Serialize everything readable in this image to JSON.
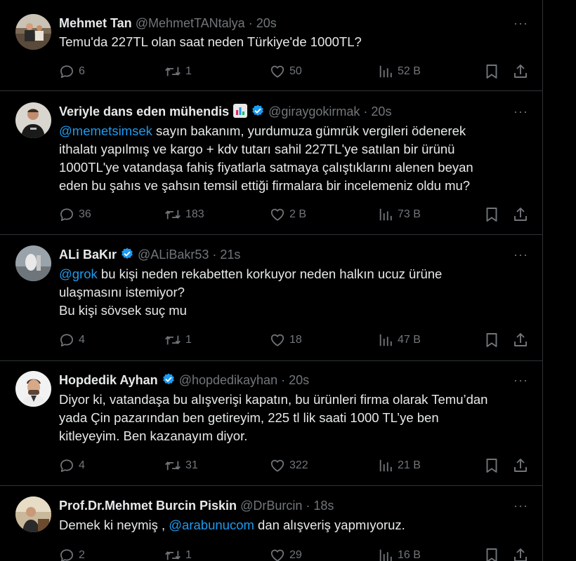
{
  "tweets": [
    {
      "name": "Mehmet Tan",
      "handle": "@MehmetTANtalya",
      "time": "20s",
      "verified": false,
      "body_lines": [
        [
          {
            "t": "Temu'da 227TL olan saat neden Türkiye'de 1000TL?"
          }
        ]
      ],
      "replies": "6",
      "reposts": "1",
      "likes": "50",
      "views": "52 B"
    },
    {
      "name": "Veriyle dans eden mühendis",
      "emoji": "bar-chart-emoji",
      "handle": "@giraygokirmak",
      "time": "20s",
      "verified": true,
      "body_lines": [
        [
          {
            "t": "@memetsimsek",
            "m": true
          },
          {
            "t": " sayın bakanım, yurdumuza gümrük vergileri ödenerek"
          }
        ],
        [
          {
            "t": "ithalatı yapılmış ve kargo + kdv tutarı sahil 227TL'ye satılan bir ürünü"
          }
        ],
        [
          {
            "t": "1000TL'ye vatandaşa fahiş fiyatlarla satmaya çalıştıklarını alenen beyan"
          }
        ],
        [
          {
            "t": "eden bu şahıs ve şahsın temsil ettiği firmalara bir incelemeniz oldu mu?"
          }
        ]
      ],
      "replies": "36",
      "reposts": "183",
      "likes": "2 B",
      "views": "73 B"
    },
    {
      "name": "ALi BaKır",
      "handle": "@ALiBakr53",
      "time": "21s",
      "verified": true,
      "body_lines": [
        [
          {
            "t": "@grok",
            "m": true
          },
          {
            "t": " bu kişi neden rekabetten korkuyor neden halkın ucuz ürüne"
          }
        ],
        [
          {
            "t": "ulaşmasını istemiyor?"
          }
        ],
        [
          {
            "t": "Bu kişi sövsek suç mu"
          }
        ]
      ],
      "replies": "4",
      "reposts": "1",
      "likes": "18",
      "views": "47 B"
    },
    {
      "name": "Hopdedik Ayhan",
      "handle": "@hopdedikayhan",
      "time": "20s",
      "verified": true,
      "body_lines": [
        [
          {
            "t": "Diyor ki, vatandaşa bu alışverişi kapatın, bu ürünleri firma olarak Temu’dan"
          }
        ],
        [
          {
            "t": "yada Çin pazarından ben getireyim, 225 tl lik saati 1000 TL’ye ben"
          }
        ],
        [
          {
            "t": "kitleyeyim. Ben kazanayım diyor."
          }
        ]
      ],
      "replies": "4",
      "reposts": "31",
      "likes": "322",
      "views": "21 B"
    },
    {
      "name": "Prof.Dr.Mehmet Burcin Piskin",
      "handle": "@DrBurcin",
      "time": "18s",
      "verified": false,
      "body_lines": [
        [
          {
            "t": "Demek ki neymiş , "
          },
          {
            "t": "@arabunucom",
            "m": true
          },
          {
            "t": " dan alışveriş yapmıyoruz."
          }
        ]
      ],
      "replies": "2",
      "reposts": "1",
      "likes": "29",
      "views": "16 B"
    }
  ],
  "ui": {
    "dot": "·",
    "more": "···"
  },
  "colors": {
    "background": "#000000",
    "text": "#e7e9ea",
    "muted": "#71767b",
    "accent": "#1d9bf0",
    "divider": "#2f3336"
  }
}
